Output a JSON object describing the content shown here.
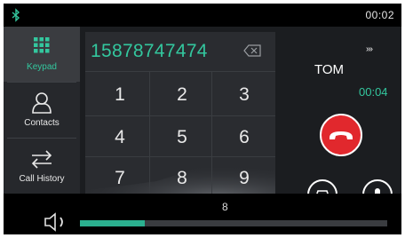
{
  "status": {
    "time": "00:02",
    "bluetooth_icon": "bluetooth-icon"
  },
  "sidebar": {
    "items": [
      {
        "label": "Keypad",
        "icon": "keypad-icon",
        "active": true
      },
      {
        "label": "Contacts",
        "icon": "contact-person-icon",
        "active": false
      },
      {
        "label": "Call History",
        "icon": "swap-arrows-icon",
        "active": false
      }
    ]
  },
  "keypad": {
    "number": "15878747474",
    "keys": [
      "1",
      "2",
      "3",
      "4",
      "5",
      "6",
      "7",
      "8",
      "9"
    ]
  },
  "call": {
    "name": "TOM",
    "duration": "00:04",
    "indicator": "›››"
  },
  "volume": {
    "level": 8,
    "fraction": 0.21
  },
  "colors": {
    "accent": "#33c79e",
    "hangup": "#e1282d",
    "background": "#1b1d20"
  }
}
